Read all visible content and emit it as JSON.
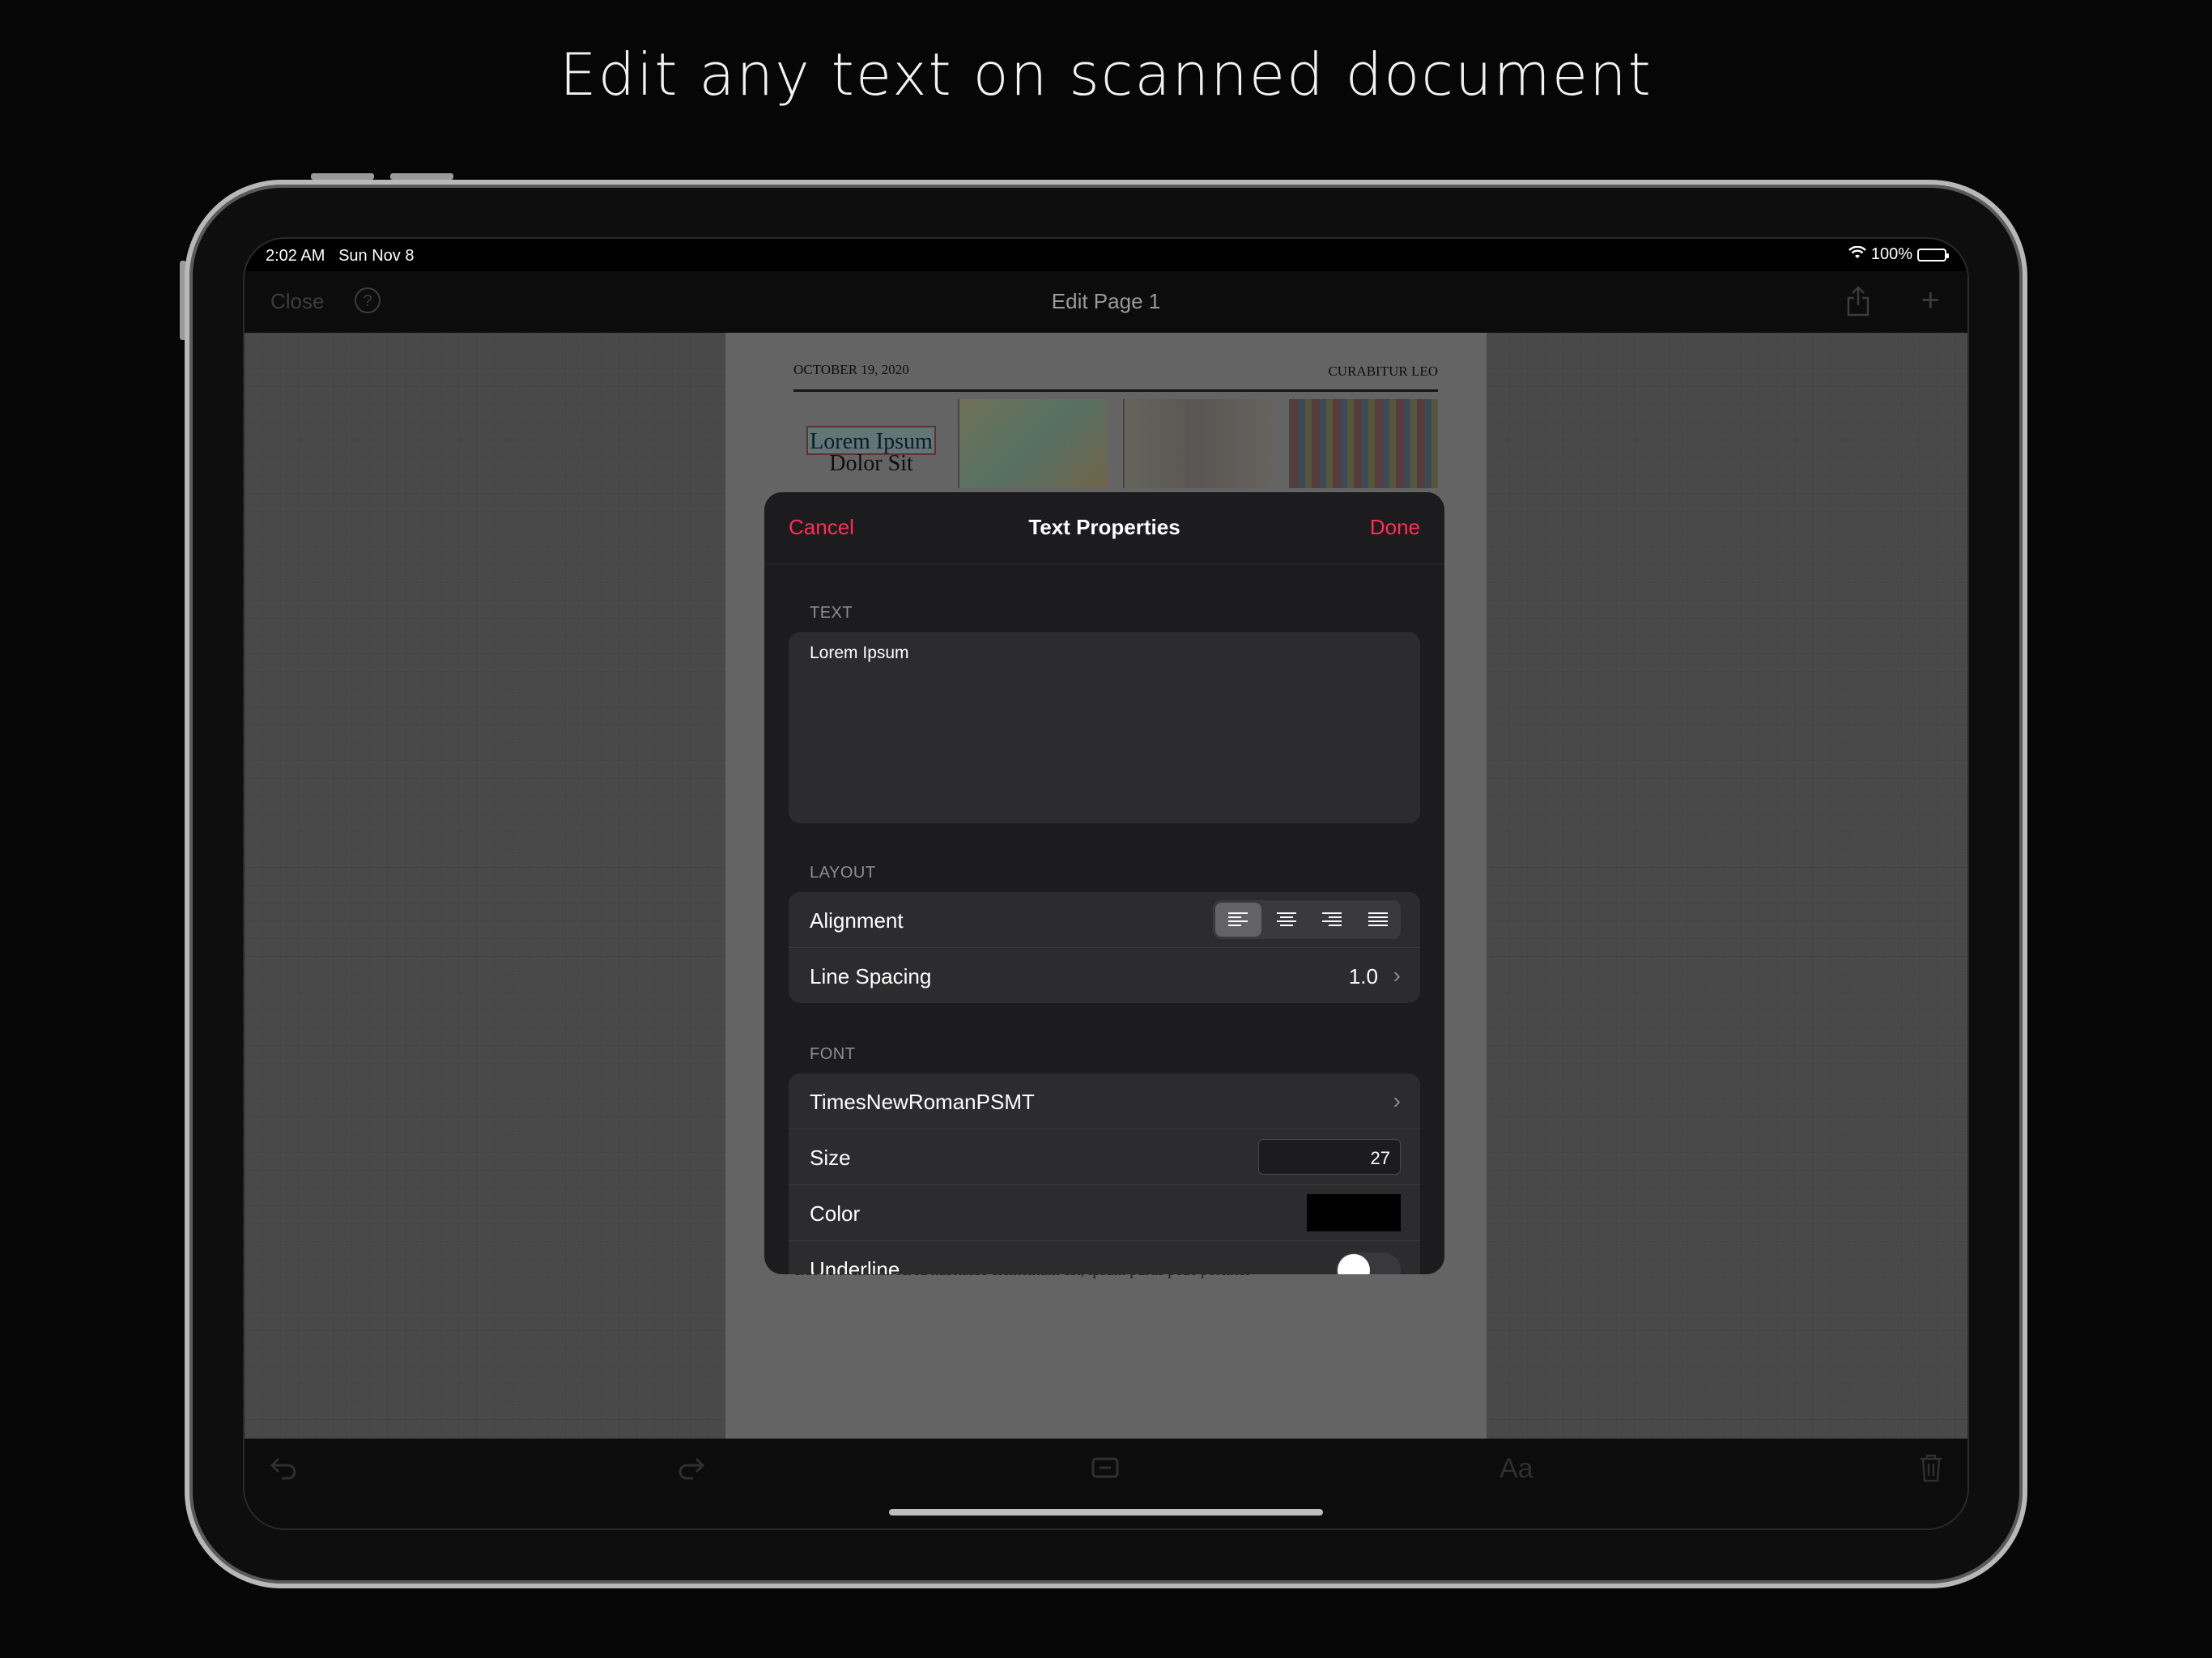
{
  "headline": "Edit any text on scanned document",
  "status": {
    "time": "2:02 AM",
    "date": "Sun Nov 8",
    "battery": "100%"
  },
  "nav": {
    "close": "Close",
    "help": "?",
    "title": "Edit Page 1"
  },
  "page": {
    "date": "OCTOBER 19, 2020",
    "section": "CURABITUR LEO",
    "selected_text": "Lorem Ipsum",
    "heading_line2": "Dolor Sit",
    "body_line": "cras fermentum. Arcu habitasse elementum est, ipsum purus pede porttitor"
  },
  "toolbar": {
    "font_button": "Aa"
  },
  "modal": {
    "cancel": "Cancel",
    "title": "Text Properties",
    "done": "Done",
    "text_section": "TEXT",
    "text_value": "Lorem Ipsum",
    "layout_section": "LAYOUT",
    "alignment_label": "Alignment",
    "alignment_selected": "left",
    "line_spacing_label": "Line Spacing",
    "line_spacing_value": "1.0",
    "font_section": "FONT",
    "font_name": "TimesNewRomanPSMT",
    "size_label": "Size",
    "size_value": "27",
    "color_label": "Color",
    "color_value": "#000000",
    "underline_label": "Underline",
    "underline_on": false
  },
  "colors": {
    "accent": "#ff2d55",
    "modal_bg": "#1c1c1e",
    "row_bg": "#2c2c2e"
  }
}
